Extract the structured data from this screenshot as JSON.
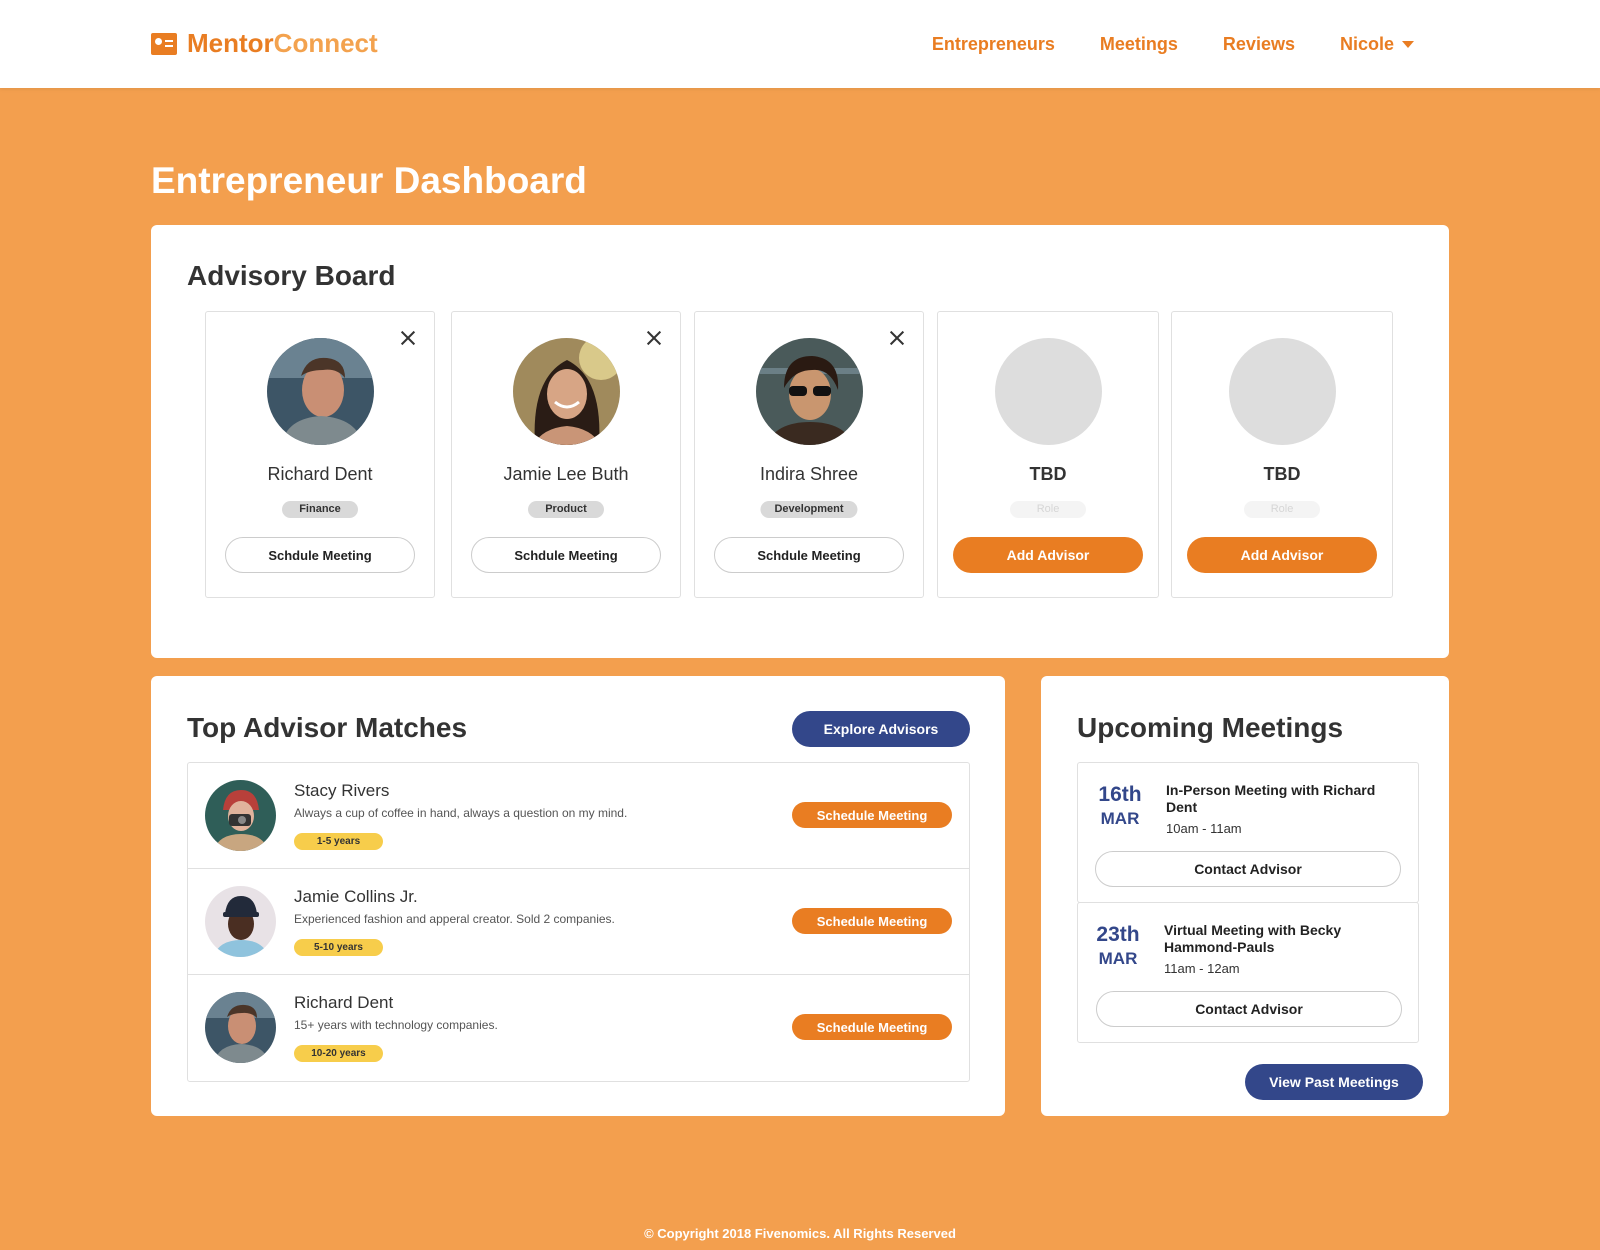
{
  "brand": {
    "name_part1": "Mentor",
    "name_part2": "Connect"
  },
  "nav": {
    "items": [
      "Entrepreneurs",
      "Meetings",
      "Reviews"
    ],
    "user": "Nicole"
  },
  "page_title": "Entrepreneur Dashboard",
  "advisory_board": {
    "title": "Advisory Board",
    "advisors": [
      {
        "name": "Richard Dent",
        "role": "Finance",
        "action": "Schdule Meeting"
      },
      {
        "name": "Jamie Lee Buth",
        "role": "Product",
        "action": "Schdule Meeting"
      },
      {
        "name": "Indira Shree",
        "role": "Development",
        "action": "Schdule Meeting"
      },
      {
        "name": "TBD",
        "role": "Role",
        "action": "Add Advisor"
      },
      {
        "name": "TBD",
        "role": "Role",
        "action": "Add Advisor"
      }
    ]
  },
  "matches": {
    "title": "Top Advisor Matches",
    "explore_label": "Explore Advisors",
    "items": [
      {
        "name": "Stacy Rivers",
        "desc": "Always a cup of coffee in hand, always a question on my mind.",
        "years": "1-5 years",
        "action": "Schedule Meeting"
      },
      {
        "name": "Jamie Collins Jr.",
        "desc": "Experienced fashion and apperal creator. Sold 2 companies.",
        "years": "5-10 years",
        "action": "Schedule Meeting"
      },
      {
        "name": "Richard Dent",
        "desc": "15+ years with technology companies.",
        "years": "10-20 years",
        "action": "Schedule Meeting"
      }
    ]
  },
  "meetings": {
    "title": "Upcoming Meetings",
    "items": [
      {
        "day": "16th",
        "month": "MAR",
        "title": "In-Person Meeting with Richard Dent",
        "time": "10am - 11am",
        "action": "Contact Advisor"
      },
      {
        "day": "23th",
        "month": "MAR",
        "title": "Virtual Meeting with Becky Hammond-Pauls",
        "time": "11am - 12am",
        "action": "Contact Advisor"
      }
    ],
    "past_label": "View Past Meetings"
  },
  "footer": "© Copyright 2018 Fivenomics. All Rights Reserved",
  "colors": {
    "orange": "#e97d22",
    "background": "#f39f4e",
    "navy": "#33478a",
    "tag_yellow": "#f7cd4b"
  },
  "icons": [
    "id-card-icon",
    "caret-down-icon",
    "close-icon",
    "avatar-placeholder-icon"
  ]
}
